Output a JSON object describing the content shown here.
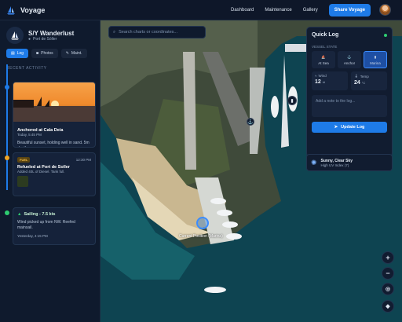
{
  "app": {
    "name": "Voyage"
  },
  "nav": {
    "items": [
      "Dashboard",
      "Maintenance",
      "Gallery"
    ],
    "cta": "Share Voyage"
  },
  "vessel": {
    "name": "S/Y Wanderlust",
    "port": "Port de Sóller"
  },
  "sidebar": {
    "tabs": [
      {
        "label": "Log",
        "icon": "book-icon"
      },
      {
        "label": "Photos",
        "icon": "camera-icon"
      },
      {
        "label": "Maint.",
        "icon": "wrench-icon"
      }
    ],
    "section_title": "RECENT ACTIVITY",
    "entries": [
      {
        "title": "Anchored at Cala Deia",
        "time": "Today, 5:45 PM",
        "body": "Beautiful sunset, holding well in sand. 5m depth."
      },
      {
        "tag": "FUEL",
        "time_right": "12:30 PM",
        "title": "Refueled at Port de Soller",
        "body": "Added 40L of Diesel. Tank full."
      },
      {
        "title": "Sailing - 7.5 kts",
        "body": "Wind picked up from NW. Reefed mainsail.",
        "meta": "Yesterday, 4:15 PM"
      }
    ]
  },
  "map": {
    "search_placeholder": "Search charts or coordinates...",
    "position_label": "Current Position (Marina)"
  },
  "quicklog": {
    "title": "Quick Log",
    "state_label": "VESSEL STATE",
    "states": [
      {
        "label": "At Sea",
        "icon": "sailboat-icon"
      },
      {
        "label": "Anchor",
        "icon": "anchor-icon"
      },
      {
        "label": "Marina",
        "icon": "dock-icon",
        "active": true
      }
    ],
    "wind": {
      "label": "Wind",
      "value": "12",
      "unit": "kt"
    },
    "temp": {
      "label": "Temp",
      "value": "24",
      "unit": "°C"
    },
    "note_placeholder": "Add a note to the log...",
    "button": "Update Log"
  },
  "weather": {
    "title": "Sunny, Clear Sky",
    "subtitle": "High UV Index (7)"
  },
  "colors": {
    "accent": "#1e7be8",
    "background": "#0b1424",
    "panel": "#111c30",
    "online": "#2ecc71"
  }
}
